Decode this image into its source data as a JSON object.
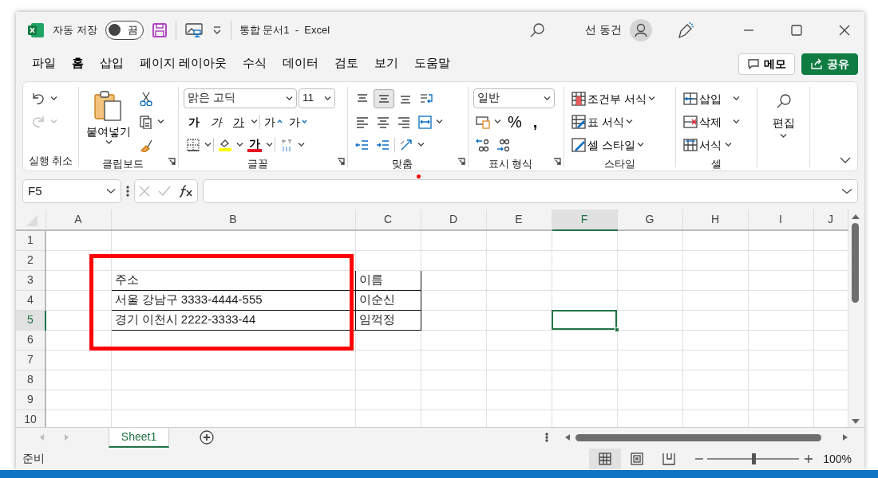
{
  "title_bar": {
    "autosave_label": "자동 저장",
    "autosave": {
      "on": false,
      "label": "끔"
    },
    "document_title": "통합 문서1  -  Excel",
    "user_name": "선 동건"
  },
  "menu_tabs": [
    {
      "label": "파일",
      "selected": false
    },
    {
      "label": "홈",
      "selected": true
    },
    {
      "label": "삽입",
      "selected": false
    },
    {
      "label": "페이지 레이아웃",
      "selected": false
    },
    {
      "label": "수식",
      "selected": false
    },
    {
      "label": "데이터",
      "selected": false
    },
    {
      "label": "검토",
      "selected": false
    },
    {
      "label": "보기",
      "selected": false
    },
    {
      "label": "도움말",
      "selected": false
    }
  ],
  "comment_button": "메모",
  "share_button": "공유",
  "ribbon": {
    "undo": {
      "disabled": false
    },
    "redo": {
      "disabled": true
    },
    "undo_group": "실행 취소",
    "clipboard": {
      "paste": "붙여넣기",
      "group": "클립보드"
    },
    "font": {
      "name": "맑은 고딕",
      "size": "11",
      "styles": [
        {
          "kind": "bold",
          "label": "가"
        },
        {
          "kind": "italic",
          "label": "가"
        },
        {
          "kind": "underline",
          "label": "가"
        }
      ],
      "resize": [
        {
          "kind": "grow",
          "label": "가"
        },
        {
          "kind": "shrink",
          "label": "가"
        }
      ],
      "font_color_label": "가",
      "group": "글꼴"
    },
    "alignment": {
      "vertical": [
        {
          "selected": false
        },
        {
          "selected": true
        },
        {
          "selected": false
        }
      ],
      "group": "맞춤"
    },
    "number": {
      "format": "일반",
      "symbols": [
        "%",
        ","
      ],
      "group": "표시 형식"
    },
    "styles": {
      "items": [
        "조건부 서식",
        "표 서식",
        "셀 스타일"
      ],
      "group": "스타일"
    },
    "cells": {
      "items": [
        "삽입",
        "삭제",
        "서식"
      ],
      "group": "셀"
    },
    "editing": {
      "label": "편집"
    }
  },
  "formula_bar": {
    "name_box": "F5"
  },
  "sheet": {
    "columns": [
      {
        "label": "A",
        "selected": false
      },
      {
        "label": "B",
        "selected": false
      },
      {
        "label": "C",
        "selected": false
      },
      {
        "label": "D",
        "selected": false
      },
      {
        "label": "E",
        "selected": false
      },
      {
        "label": "F",
        "selected": true
      },
      {
        "label": "G",
        "selected": false
      },
      {
        "label": "H",
        "selected": false
      },
      {
        "label": "I",
        "selected": false
      },
      {
        "label": "J",
        "selected": false
      }
    ],
    "rows": [
      {
        "label": "1",
        "selected": false
      },
      {
        "label": "2",
        "selected": false
      },
      {
        "label": "3",
        "selected": false
      },
      {
        "label": "4",
        "selected": false
      },
      {
        "label": "5",
        "selected": true
      },
      {
        "label": "6",
        "selected": false
      },
      {
        "label": "7",
        "selected": false
      },
      {
        "label": "8",
        "selected": false
      },
      {
        "label": "9",
        "selected": false
      },
      {
        "label": "10",
        "selected": false
      }
    ],
    "data_table": {
      "bordered": true,
      "rows": [
        [
          "주소",
          "이름"
        ],
        [
          "서울 강남구 3333-4444-555",
          "이순신"
        ],
        [
          "경기 이천시 2222-3333-44",
          "임꺽정"
        ]
      ]
    }
  },
  "sheet_tabs": [
    {
      "label": "Sheet1",
      "selected": true
    }
  ],
  "status_bar": {
    "status": "준비",
    "views": [
      {
        "kind": "normal",
        "selected": true
      },
      {
        "kind": "page_layout",
        "selected": false
      },
      {
        "kind": "page_break",
        "selected": false
      }
    ],
    "zoom": {
      "level": 0.5,
      "label": "100%"
    }
  }
}
